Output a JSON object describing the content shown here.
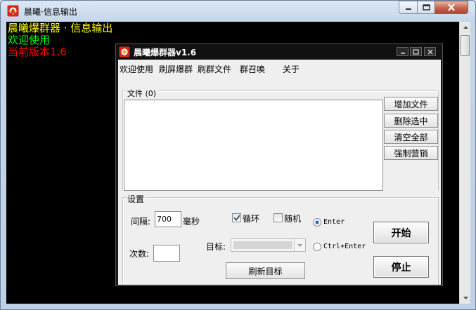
{
  "outer_window": {
    "title": "晨曦·信息输出",
    "icon": "app-logo-icon"
  },
  "console": {
    "lines": [
      {
        "text": "晨曦爆群器 · 信息输出",
        "color": "#ffff00"
      },
      {
        "text": "欢迎使用",
        "color": "#00ff00"
      },
      {
        "text": "当前版本1.6",
        "color": "#ff0000"
      }
    ]
  },
  "app_window": {
    "title": "晨曦爆群器v1.6",
    "menu": [
      "欢迎使用",
      "刷屏爆群",
      "刷群文件",
      "群召唤",
      "关于"
    ],
    "files": {
      "group_label": "文件 (0)",
      "buttons": [
        "增加文件",
        "删除选中",
        "清空全部",
        "强制营销"
      ]
    },
    "settings": {
      "group_label": "设置",
      "interval_label": "间隔:",
      "interval_value": "700",
      "interval_unit": "毫秒",
      "count_label": "次数:",
      "count_value": "",
      "loop_label": "循环",
      "loop_checked": true,
      "random_label": "随机",
      "random_checked": false,
      "enter_label": "Enter",
      "enter_selected": true,
      "ctrl_enter_label": "Ctrl+Enter",
      "target_label": "目标:",
      "target_value": "",
      "refresh_label": "刷新目标",
      "start_label": "开始",
      "stop_label": "停止"
    }
  },
  "colors": {
    "console_bg": "#000000",
    "app_bg": "#efefef",
    "close_button": "#c2664f"
  }
}
